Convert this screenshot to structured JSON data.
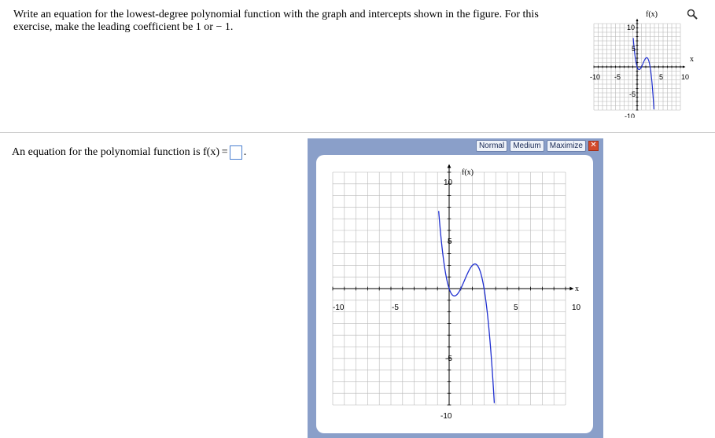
{
  "question": {
    "text": "Write an equation for the lowest-degree polynomial function with the graph and intercepts shown in the figure. For this exercise, make the leading coefficient be 1 or − 1."
  },
  "answer": {
    "prefix": "An equation for the polynomial function is f(x) =",
    "suffix": "."
  },
  "panel": {
    "buttons": [
      "Normal",
      "Medium",
      "Maximize"
    ],
    "close": "✕"
  },
  "graph": {
    "y_label": "f(x)",
    "x_label": "x",
    "x_ticks": [
      "-10",
      "-5",
      "5",
      "10"
    ],
    "y_ticks": [
      "10",
      "5",
      "-5",
      "-10"
    ]
  },
  "icons": {
    "zoom": "magnifier-icon"
  },
  "colors": {
    "curve": "#1f2fd0",
    "grid": "#b8b8b8",
    "panel": "#8a9fc9",
    "answer_box": "#4a7fd0"
  },
  "chart_data": {
    "type": "line",
    "x_range": [
      -10,
      10
    ],
    "y_range": [
      -10,
      10
    ],
    "grid": true,
    "y_label": "f(x)",
    "x_label": "x",
    "x_intercepts": [
      0,
      1,
      3
    ],
    "local_min": [
      1,
      -2
    ],
    "local_max": [
      3,
      1
    ]
  }
}
